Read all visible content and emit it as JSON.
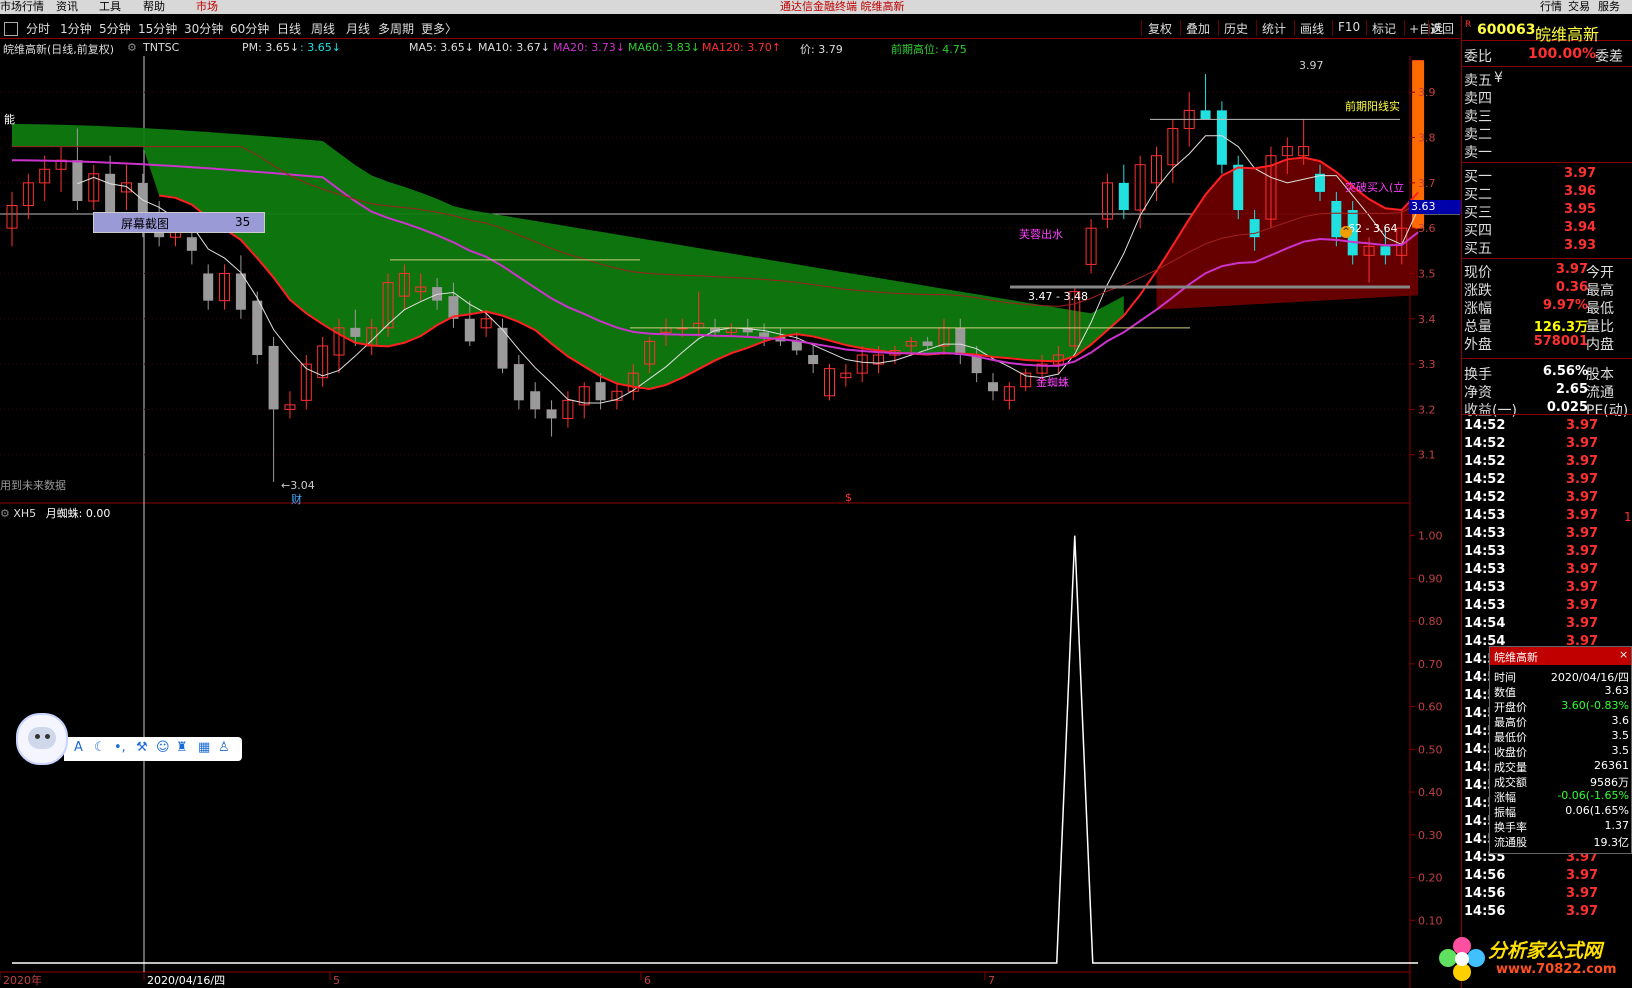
{
  "menu": {
    "items": [
      "市场行情",
      "资讯",
      "工具",
      "帮助",
      "市场"
    ],
    "title": "通达信金融终端  皖维高新",
    "right_items": [
      "行情",
      "交易",
      "服务"
    ]
  },
  "periods": [
    "分时",
    "1分钟",
    "5分钟",
    "15分钟",
    "30分钟",
    "60分钟",
    "日线",
    "周线",
    "月线",
    "多周期",
    "更多〉"
  ],
  "tools": [
    "复权",
    "叠加",
    "历史",
    "统计",
    "画线",
    "F10",
    "标记",
    "+自选",
    "返回"
  ],
  "header": {
    "stock_title": "皖维高新(日线,前复权)",
    "indicator": "TNTSC",
    "pm": "PM: 3.65↓",
    "pm2": ": 3.65↓",
    "ma5": "MA5: 3.65↓",
    "ma10": "MA10: 3.67↓",
    "ma20": "MA20: 3.73↓",
    "ma60": "MA60: 3.83↓",
    "ma120": "MA120: 3.70↑",
    "price": "价: 3.79",
    "prev_high": "前期高位: 4.75"
  },
  "chart_data": [
    {
      "type": "candlestick",
      "y_ticks": [
        3.1,
        3.2,
        3.3,
        3.4,
        3.5,
        3.6,
        3.7,
        3.8,
        3.9
      ],
      "ylim": [
        3.0,
        3.98
      ],
      "x_labels": [
        "2020年",
        "2020/04/16/四",
        "5",
        "6",
        "7"
      ],
      "current_price_label": "3.63",
      "annotations": {
        "low": "←3.04",
        "high": "3.97",
        "range1": "3.47 - 3.48",
        "range2": "62 - 3.64",
        "prev_yang": "前期阳线实",
        "breakout": "突破买入(立",
        "golden_spider": "金蜘蛛",
        "hibiscus": "芙蓉出水",
        "future_data": "用到未来数据",
        "finance": "财",
        "dollar": "$",
        "neng": "能"
      },
      "candles": [
        {
          "o": 3.6,
          "h": 3.68,
          "l": 3.56,
          "c": 3.65
        },
        {
          "o": 3.65,
          "h": 3.72,
          "l": 3.62,
          "c": 3.7
        },
        {
          "o": 3.7,
          "h": 3.76,
          "l": 3.66,
          "c": 3.73
        },
        {
          "o": 3.73,
          "h": 3.78,
          "l": 3.68,
          "c": 3.75
        },
        {
          "o": 3.75,
          "h": 3.82,
          "l": 3.64,
          "c": 3.66
        },
        {
          "o": 3.66,
          "h": 3.74,
          "l": 3.64,
          "c": 3.72
        },
        {
          "o": 3.72,
          "h": 3.76,
          "l": 3.62,
          "c": 3.63
        },
        {
          "o": 3.68,
          "h": 3.74,
          "l": 3.64,
          "c": 3.7
        },
        {
          "o": 3.7,
          "h": 3.72,
          "l": 3.58,
          "c": 3.6
        },
        {
          "o": 3.62,
          "h": 3.66,
          "l": 3.56,
          "c": 3.58
        },
        {
          "o": 3.58,
          "h": 3.62,
          "l": 3.56,
          "c": 3.6
        },
        {
          "o": 3.58,
          "h": 3.62,
          "l": 3.52,
          "c": 3.55
        },
        {
          "o": 3.5,
          "h": 3.52,
          "l": 3.42,
          "c": 3.44
        },
        {
          "o": 3.44,
          "h": 3.52,
          "l": 3.42,
          "c": 3.5
        },
        {
          "o": 3.5,
          "h": 3.54,
          "l": 3.4,
          "c": 3.42
        },
        {
          "o": 3.44,
          "h": 3.46,
          "l": 3.3,
          "c": 3.32
        },
        {
          "o": 3.34,
          "h": 3.36,
          "l": 3.04,
          "c": 3.2
        },
        {
          "o": 3.2,
          "h": 3.24,
          "l": 3.18,
          "c": 3.21
        },
        {
          "o": 3.22,
          "h": 3.32,
          "l": 3.2,
          "c": 3.3
        },
        {
          "o": 3.27,
          "h": 3.36,
          "l": 3.25,
          "c": 3.34
        },
        {
          "o": 3.32,
          "h": 3.4,
          "l": 3.28,
          "c": 3.38
        },
        {
          "o": 3.38,
          "h": 3.42,
          "l": 3.34,
          "c": 3.36
        },
        {
          "o": 3.34,
          "h": 3.4,
          "l": 3.32,
          "c": 3.38
        },
        {
          "o": 3.38,
          "h": 3.5,
          "l": 3.36,
          "c": 3.48
        },
        {
          "o": 3.45,
          "h": 3.52,
          "l": 3.42,
          "c": 3.5
        },
        {
          "o": 3.46,
          "h": 3.5,
          "l": 3.44,
          "c": 3.47
        },
        {
          "o": 3.47,
          "h": 3.49,
          "l": 3.42,
          "c": 3.44
        },
        {
          "o": 3.45,
          "h": 3.48,
          "l": 3.38,
          "c": 3.4
        },
        {
          "o": 3.4,
          "h": 3.44,
          "l": 3.34,
          "c": 3.35
        },
        {
          "o": 3.38,
          "h": 3.42,
          "l": 3.36,
          "c": 3.4
        },
        {
          "o": 3.38,
          "h": 3.4,
          "l": 3.28,
          "c": 3.29
        },
        {
          "o": 3.3,
          "h": 3.32,
          "l": 3.2,
          "c": 3.22
        },
        {
          "o": 3.24,
          "h": 3.26,
          "l": 3.18,
          "c": 3.2
        },
        {
          "o": 3.2,
          "h": 3.22,
          "l": 3.14,
          "c": 3.18
        },
        {
          "o": 3.18,
          "h": 3.24,
          "l": 3.16,
          "c": 3.22
        },
        {
          "o": 3.21,
          "h": 3.26,
          "l": 3.18,
          "c": 3.25
        },
        {
          "o": 3.26,
          "h": 3.28,
          "l": 3.2,
          "c": 3.22
        },
        {
          "o": 3.22,
          "h": 3.26,
          "l": 3.2,
          "c": 3.24
        },
        {
          "o": 3.24,
          "h": 3.3,
          "l": 3.22,
          "c": 3.28
        },
        {
          "o": 3.3,
          "h": 3.36,
          "l": 3.28,
          "c": 3.35
        },
        {
          "o": 3.37,
          "h": 3.4,
          "l": 3.34,
          "c": 3.38
        },
        {
          "o": 3.38,
          "h": 3.4,
          "l": 3.36,
          "c": 3.38
        },
        {
          "o": 3.38,
          "h": 3.46,
          "l": 3.36,
          "c": 3.39
        },
        {
          "o": 3.38,
          "h": 3.4,
          "l": 3.36,
          "c": 3.37
        },
        {
          "o": 3.37,
          "h": 3.39,
          "l": 3.36,
          "c": 3.38
        },
        {
          "o": 3.38,
          "h": 3.4,
          "l": 3.36,
          "c": 3.37
        },
        {
          "o": 3.37,
          "h": 3.39,
          "l": 3.34,
          "c": 3.36
        },
        {
          "o": 3.36,
          "h": 3.38,
          "l": 3.34,
          "c": 3.35
        },
        {
          "o": 3.35,
          "h": 3.37,
          "l": 3.32,
          "c": 3.33
        },
        {
          "o": 3.32,
          "h": 3.34,
          "l": 3.28,
          "c": 3.3
        },
        {
          "o": 3.23,
          "h": 3.3,
          "l": 3.22,
          "c": 3.29
        },
        {
          "o": 3.27,
          "h": 3.3,
          "l": 3.25,
          "c": 3.28
        },
        {
          "o": 3.28,
          "h": 3.34,
          "l": 3.26,
          "c": 3.32
        },
        {
          "o": 3.3,
          "h": 3.34,
          "l": 3.28,
          "c": 3.32
        },
        {
          "o": 3.32,
          "h": 3.34,
          "l": 3.3,
          "c": 3.33
        },
        {
          "o": 3.34,
          "h": 3.36,
          "l": 3.32,
          "c": 3.35
        },
        {
          "o": 3.35,
          "h": 3.36,
          "l": 3.33,
          "c": 3.34
        },
        {
          "o": 3.34,
          "h": 3.4,
          "l": 3.32,
          "c": 3.38
        },
        {
          "o": 3.38,
          "h": 3.4,
          "l": 3.3,
          "c": 3.32
        },
        {
          "o": 3.32,
          "h": 3.34,
          "l": 3.26,
          "c": 3.28
        },
        {
          "o": 3.26,
          "h": 3.28,
          "l": 3.22,
          "c": 3.24
        },
        {
          "o": 3.22,
          "h": 3.26,
          "l": 3.2,
          "c": 3.25
        },
        {
          "o": 3.25,
          "h": 3.29,
          "l": 3.24,
          "c": 3.28
        },
        {
          "o": 3.28,
          "h": 3.32,
          "l": 3.26,
          "c": 3.3
        },
        {
          "o": 3.3,
          "h": 3.34,
          "l": 3.28,
          "c": 3.32
        },
        {
          "o": 3.34,
          "h": 3.47,
          "l": 3.33,
          "c": 3.46
        },
        {
          "o": 3.52,
          "h": 3.62,
          "l": 3.5,
          "c": 3.6
        },
        {
          "o": 3.62,
          "h": 3.72,
          "l": 3.6,
          "c": 3.7
        },
        {
          "o": 3.7,
          "h": 3.74,
          "l": 3.62,
          "c": 3.64
        },
        {
          "o": 3.64,
          "h": 3.76,
          "l": 3.6,
          "c": 3.74
        },
        {
          "o": 3.7,
          "h": 3.78,
          "l": 3.66,
          "c": 3.76
        },
        {
          "o": 3.74,
          "h": 3.84,
          "l": 3.7,
          "c": 3.82
        },
        {
          "o": 3.82,
          "h": 3.9,
          "l": 3.78,
          "c": 3.86
        },
        {
          "o": 3.86,
          "h": 3.94,
          "l": 3.84,
          "c": 3.84
        },
        {
          "o": 3.86,
          "h": 3.88,
          "l": 3.72,
          "c": 3.74
        },
        {
          "o": 3.74,
          "h": 3.76,
          "l": 3.62,
          "c": 3.64
        },
        {
          "o": 3.62,
          "h": 3.64,
          "l": 3.55,
          "c": 3.58
        },
        {
          "o": 3.62,
          "h": 3.78,
          "l": 3.6,
          "c": 3.76
        },
        {
          "o": 3.76,
          "h": 3.8,
          "l": 3.72,
          "c": 3.78
        },
        {
          "o": 3.76,
          "h": 3.84,
          "l": 3.74,
          "c": 3.78
        },
        {
          "o": 3.72,
          "h": 3.74,
          "l": 3.66,
          "c": 3.68
        },
        {
          "o": 3.66,
          "h": 3.68,
          "l": 3.56,
          "c": 3.58
        },
        {
          "o": 3.64,
          "h": 3.66,
          "l": 3.52,
          "c": 3.54
        },
        {
          "o": 3.54,
          "h": 3.58,
          "l": 3.48,
          "c": 3.56
        },
        {
          "o": 3.56,
          "h": 3.6,
          "l": 3.52,
          "c": 3.54
        },
        {
          "o": 3.54,
          "h": 3.64,
          "l": 3.52,
          "c": 3.6
        },
        {
          "o": 3.6,
          "h": 3.97,
          "l": 3.6,
          "c": 3.97
        }
      ]
    },
    {
      "type": "line",
      "indicator": "XH5",
      "series_label": "月蜘蛛: 0.00",
      "y_ticks": [
        0.1,
        0.2,
        0.3,
        0.4,
        0.5,
        0.6,
        0.7,
        0.8,
        0.9,
        1.0
      ],
      "ylim": [
        0,
        1.06
      ],
      "spike_at_candle": 65,
      "values_note": "0 everywhere except 1.00 at spike"
    }
  ],
  "quote": {
    "code": "600063",
    "name": "皖维高新",
    "weibi_label": "委比",
    "weibi_value": "100.00%",
    "weicha_label": "委差",
    "sell_labels": [
      "卖五",
      "卖四",
      "卖三",
      "卖二",
      "卖一"
    ],
    "sell_extra": "¥",
    "buy": [
      {
        "label": "买一",
        "price": "3.97"
      },
      {
        "label": "买二",
        "price": "3.96"
      },
      {
        "label": "买三",
        "price": "3.95"
      },
      {
        "label": "买四",
        "price": "3.94"
      },
      {
        "label": "买五",
        "price": "3.93"
      }
    ],
    "stats": [
      {
        "l1": "现价",
        "v": "3.97",
        "l2": "今开",
        "color": "#ff3030"
      },
      {
        "l1": "涨跌",
        "v": "0.36",
        "l2": "最高",
        "color": "#ff3030"
      },
      {
        "l1": "涨幅",
        "v": "9.97%",
        "l2": "最低",
        "color": "#ff3030"
      },
      {
        "l1": "总量",
        "v": "126.3万",
        "l2": "量比",
        "color": "#ffff00"
      },
      {
        "l1": "外盘",
        "v": "578001",
        "l2": "内盘",
        "color": "#ff3030"
      },
      {
        "l1": "换手",
        "v": "6.56%",
        "l2": "股本",
        "color": "#ffffff"
      },
      {
        "l1": "净资",
        "v": "2.65",
        "l2": "流通",
        "color": "#ffffff"
      },
      {
        "l1": "收益(一)",
        "v": "0.025",
        "l2": "PE(动)",
        "color": "#ffffff"
      }
    ],
    "ticks": [
      {
        "t": "14:52",
        "p": "3.97"
      },
      {
        "t": "14:52",
        "p": "3.97"
      },
      {
        "t": "14:52",
        "p": "3.97"
      },
      {
        "t": "14:52",
        "p": "3.97"
      },
      {
        "t": "14:52",
        "p": "3.97"
      },
      {
        "t": "14:53",
        "p": "3.97"
      },
      {
        "t": "14:53",
        "p": "3.97"
      },
      {
        "t": "14:53",
        "p": "3.97"
      },
      {
        "t": "14:53",
        "p": "3.97"
      },
      {
        "t": "14:53",
        "p": "3.97"
      },
      {
        "t": "14:53",
        "p": "3.97"
      },
      {
        "t": "14:54",
        "p": "3.97"
      },
      {
        "t": "14:54",
        "p": "3.97"
      },
      {
        "t": "14:5",
        "p": ""
      },
      {
        "t": "14:5",
        "p": ""
      },
      {
        "t": "14:5",
        "p": ""
      },
      {
        "t": "14:5",
        "p": ""
      },
      {
        "t": "14:5",
        "p": ""
      },
      {
        "t": "14:5",
        "p": ""
      },
      {
        "t": "14:5",
        "p": ""
      },
      {
        "t": "14:5",
        "p": ""
      },
      {
        "t": "14:5",
        "p": ""
      },
      {
        "t": "14:5",
        "p": ""
      },
      {
        "t": "14:55",
        "p": "3.97"
      },
      {
        "t": "14:55",
        "p": "3.97"
      },
      {
        "t": "14:56",
        "p": "3.97"
      },
      {
        "t": "14:56",
        "p": "3.97"
      },
      {
        "t": "14:56",
        "p": "3.97"
      }
    ],
    "tick_mark": "1"
  },
  "popup": {
    "title": "皖维高新",
    "close": "×",
    "rows": [
      {
        "k": "时间",
        "v": "2020/04/16/四",
        "c": "#ffffff"
      },
      {
        "k": "数值",
        "v": "3.63",
        "c": "#ffffff"
      },
      {
        "k": "开盘价",
        "v": "3.60(-0.83%",
        "c": "#30ff30"
      },
      {
        "k": "最高价",
        "v": "3.6",
        "c": "#ffffff"
      },
      {
        "k": "最低价",
        "v": "3.5",
        "c": "#ffffff"
      },
      {
        "k": "收盘价",
        "v": "3.5",
        "c": "#ffffff"
      },
      {
        "k": "成交量",
        "v": "26361",
        "c": "#ffffff"
      },
      {
        "k": "成交额",
        "v": "9586万",
        "c": "#ffffff"
      },
      {
        "k": "涨幅",
        "v": "-0.06(-1.65%",
        "c": "#30ff30"
      },
      {
        "k": "振幅",
        "v": "0.06(1.65%",
        "c": "#ffffff"
      },
      {
        "k": "换手率",
        "v": "1.37",
        "c": "#ffffff"
      },
      {
        "k": "流通股",
        "v": "19.3亿",
        "c": "#ffffff"
      }
    ]
  },
  "screenshot_label": {
    "text": "屏幕截图",
    "value": "35"
  },
  "logo": {
    "text": "分析家公式网",
    "url": "www.70822.com"
  },
  "colors": {
    "up": "#ff3030",
    "down_cyan": "#20e0e0",
    "down_gray": "#9a9a9a",
    "green_band": "#0f7a0f",
    "red_band": "#6b0000",
    "ma_magenta": "#cc33cc"
  }
}
